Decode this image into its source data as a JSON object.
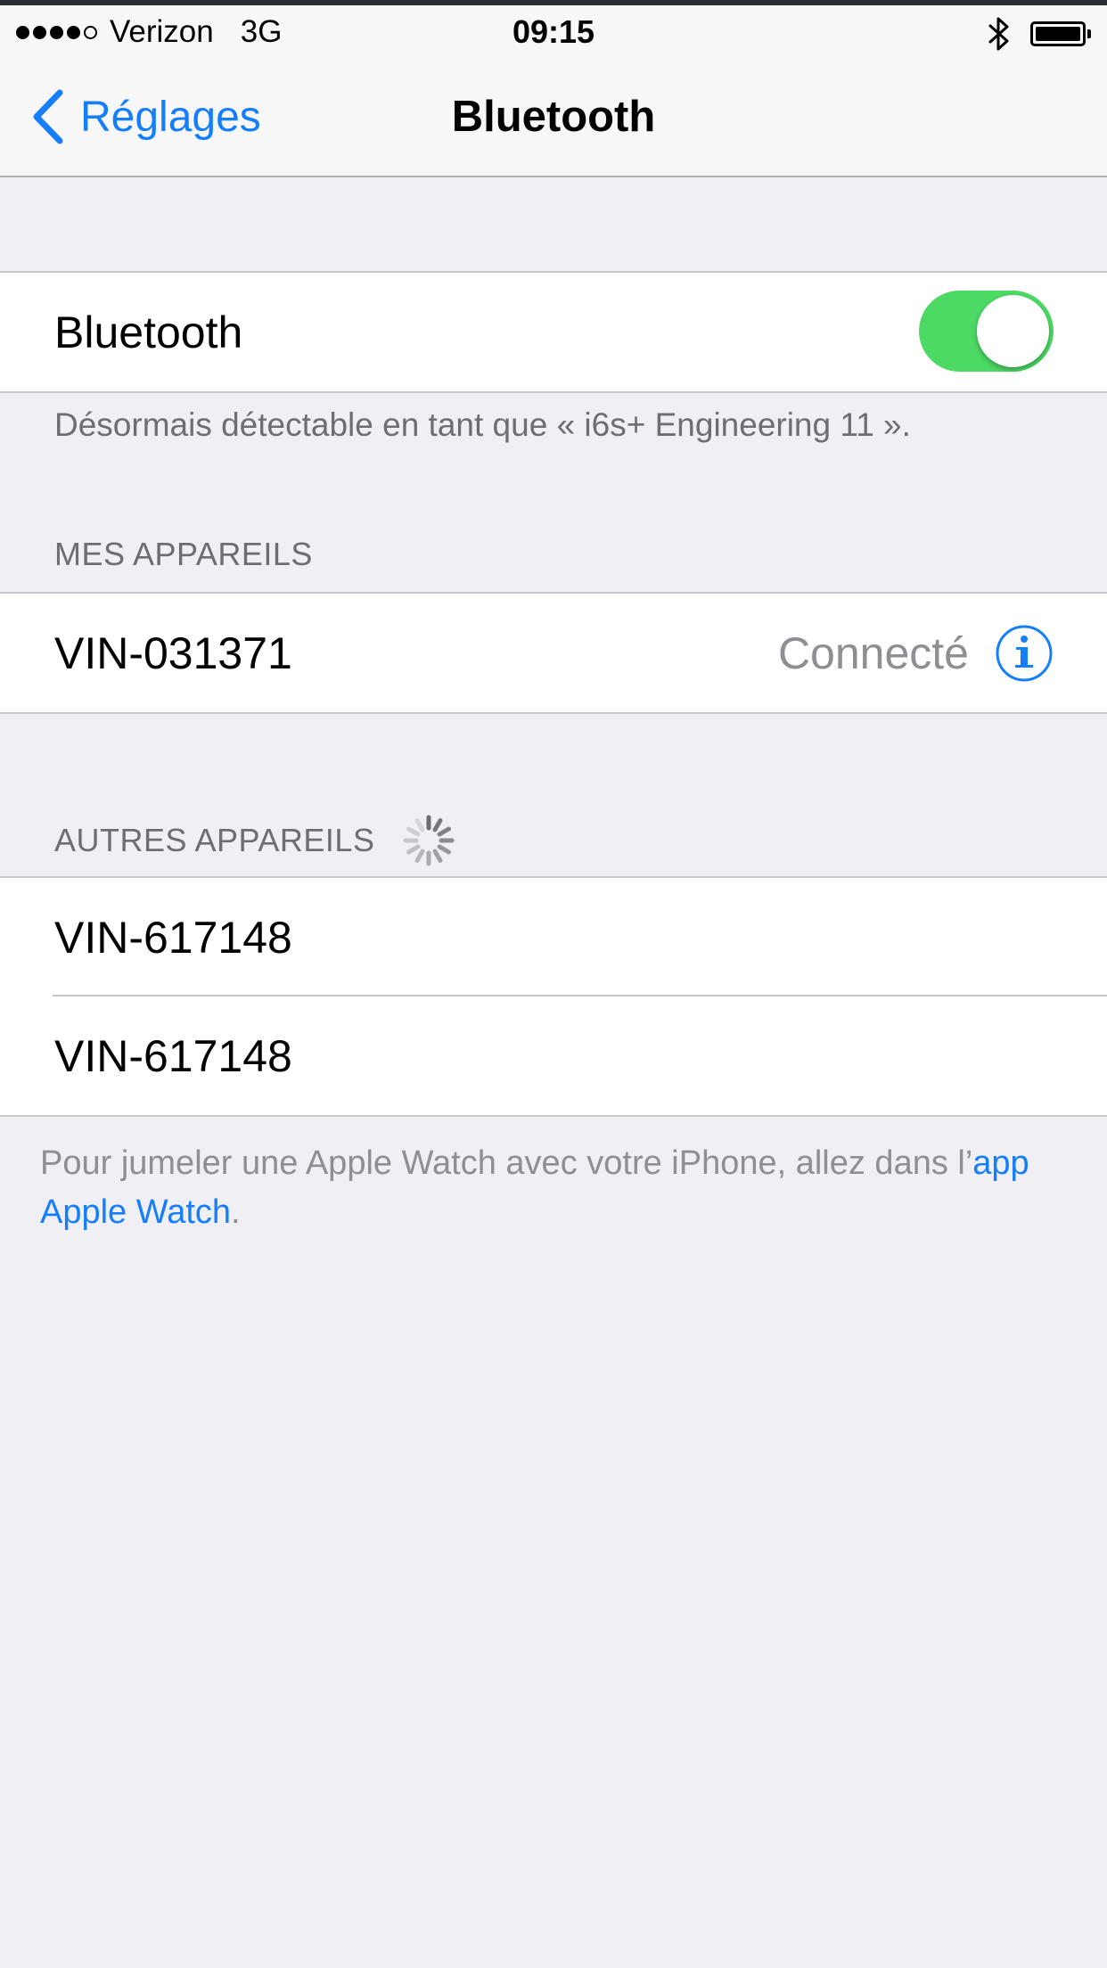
{
  "status_bar": {
    "signal_dots_filled": 4,
    "signal_dots_total": 5,
    "carrier": "Verizon",
    "network": "3G",
    "time": "09:15",
    "bluetooth_icon": "bluetooth-icon",
    "battery_icon": "battery-icon",
    "battery_level": 0.9
  },
  "nav": {
    "back_label": "Réglages",
    "title": "Bluetooth"
  },
  "bluetooth_toggle": {
    "label": "Bluetooth",
    "on": true
  },
  "discoverable_text": "Désormais détectable en tant que « i6s+ Engineering 11  ».",
  "my_devices": {
    "header": "MES APPAREILS",
    "items": [
      {
        "name": "VIN-031371",
        "status": "Connecté"
      }
    ]
  },
  "other_devices": {
    "header": "AUTRES APPAREILS",
    "items": [
      {
        "name": "VIN-617148"
      },
      {
        "name": "VIN-617148"
      }
    ]
  },
  "footer_note": {
    "prefix": "Pour jumeler une Apple Watch avec votre iPhone, allez dans l’",
    "link": "app Apple Watch",
    "suffix": "."
  },
  "colors": {
    "accent": "#157efb",
    "toggle_on": "#4cd964",
    "background": "#efeff4"
  }
}
